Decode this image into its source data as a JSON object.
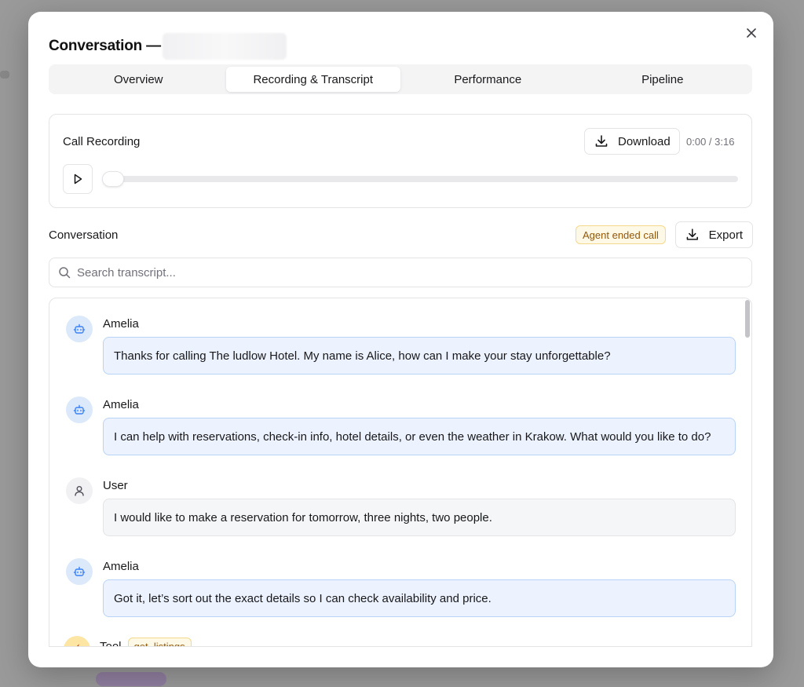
{
  "modal": {
    "title": "Conversation —",
    "close_icon": "close-icon"
  },
  "tabs": [
    {
      "label": "Overview",
      "active": false
    },
    {
      "label": "Recording & Transcript",
      "active": true
    },
    {
      "label": "Performance",
      "active": false
    },
    {
      "label": "Pipeline",
      "active": false
    }
  ],
  "recording": {
    "title": "Call Recording",
    "download_label": "Download",
    "time": "0:00 / 3:16",
    "progress": 0
  },
  "conversation": {
    "title": "Conversation",
    "badge": "Agent ended call",
    "export_label": "Export",
    "search_placeholder": "Search transcript..."
  },
  "messages": [
    {
      "role": "bot",
      "speaker": "Amelia",
      "text": "Thanks for calling The ludlow Hotel. My name is Alice, how can I make your stay unforgettable?",
      "icon": "bot-icon"
    },
    {
      "role": "bot",
      "speaker": "Amelia",
      "text": "I can help with reservations, check-in info, hotel details, or even the weather in Krakow. What would you like to do?",
      "icon": "bot-icon"
    },
    {
      "role": "user",
      "speaker": "User",
      "text": "I would like to make a reservation for tomorrow, three nights, two people.",
      "icon": "user-icon"
    },
    {
      "role": "bot",
      "speaker": "Amelia",
      "text": "Got it, let’s sort out the exact details so I can check availability and price.",
      "icon": "bot-icon"
    },
    {
      "role": "tool",
      "speaker": "Tool",
      "tag": "get_listings",
      "icon": "tool-icon"
    }
  ],
  "colors": {
    "bot_bubble": "#ecf3fe",
    "user_bubble": "#f5f6f8",
    "badge_bg": "#fef8e7",
    "badge_text": "#92590a"
  }
}
